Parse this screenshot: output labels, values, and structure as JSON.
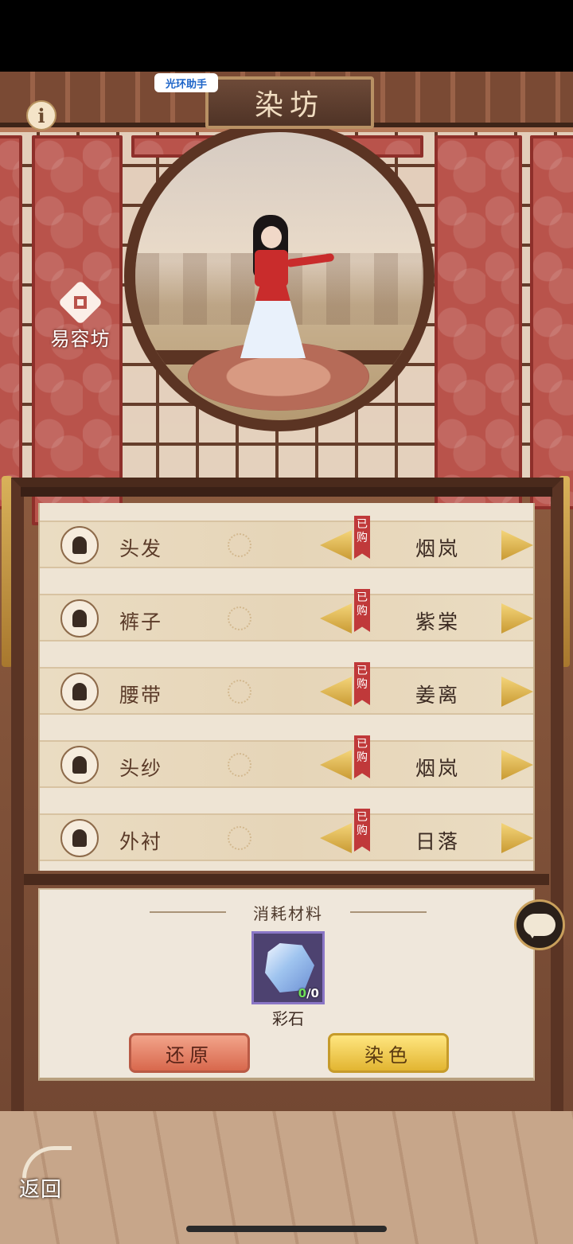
{
  "header": {
    "title": "染坊",
    "helper_badge": "光环助手"
  },
  "side_menu": {
    "yirong_label": "易容坊"
  },
  "dye_parts": [
    {
      "part": "头发",
      "owned_tag": "已购",
      "color": "烟岚"
    },
    {
      "part": "裤子",
      "owned_tag": "已购",
      "color": "紫棠"
    },
    {
      "part": "腰带",
      "owned_tag": "已购",
      "color": "姜离"
    },
    {
      "part": "头纱",
      "owned_tag": "已购",
      "color": "烟岚"
    },
    {
      "part": "外衬",
      "owned_tag": "已购",
      "color": "日落"
    }
  ],
  "materials": {
    "title": "消耗材料",
    "item_name": "彩石",
    "have": "0",
    "need": "/0"
  },
  "actions": {
    "restore_label": "还原",
    "dye_label": "染色",
    "back_label": "返回"
  }
}
